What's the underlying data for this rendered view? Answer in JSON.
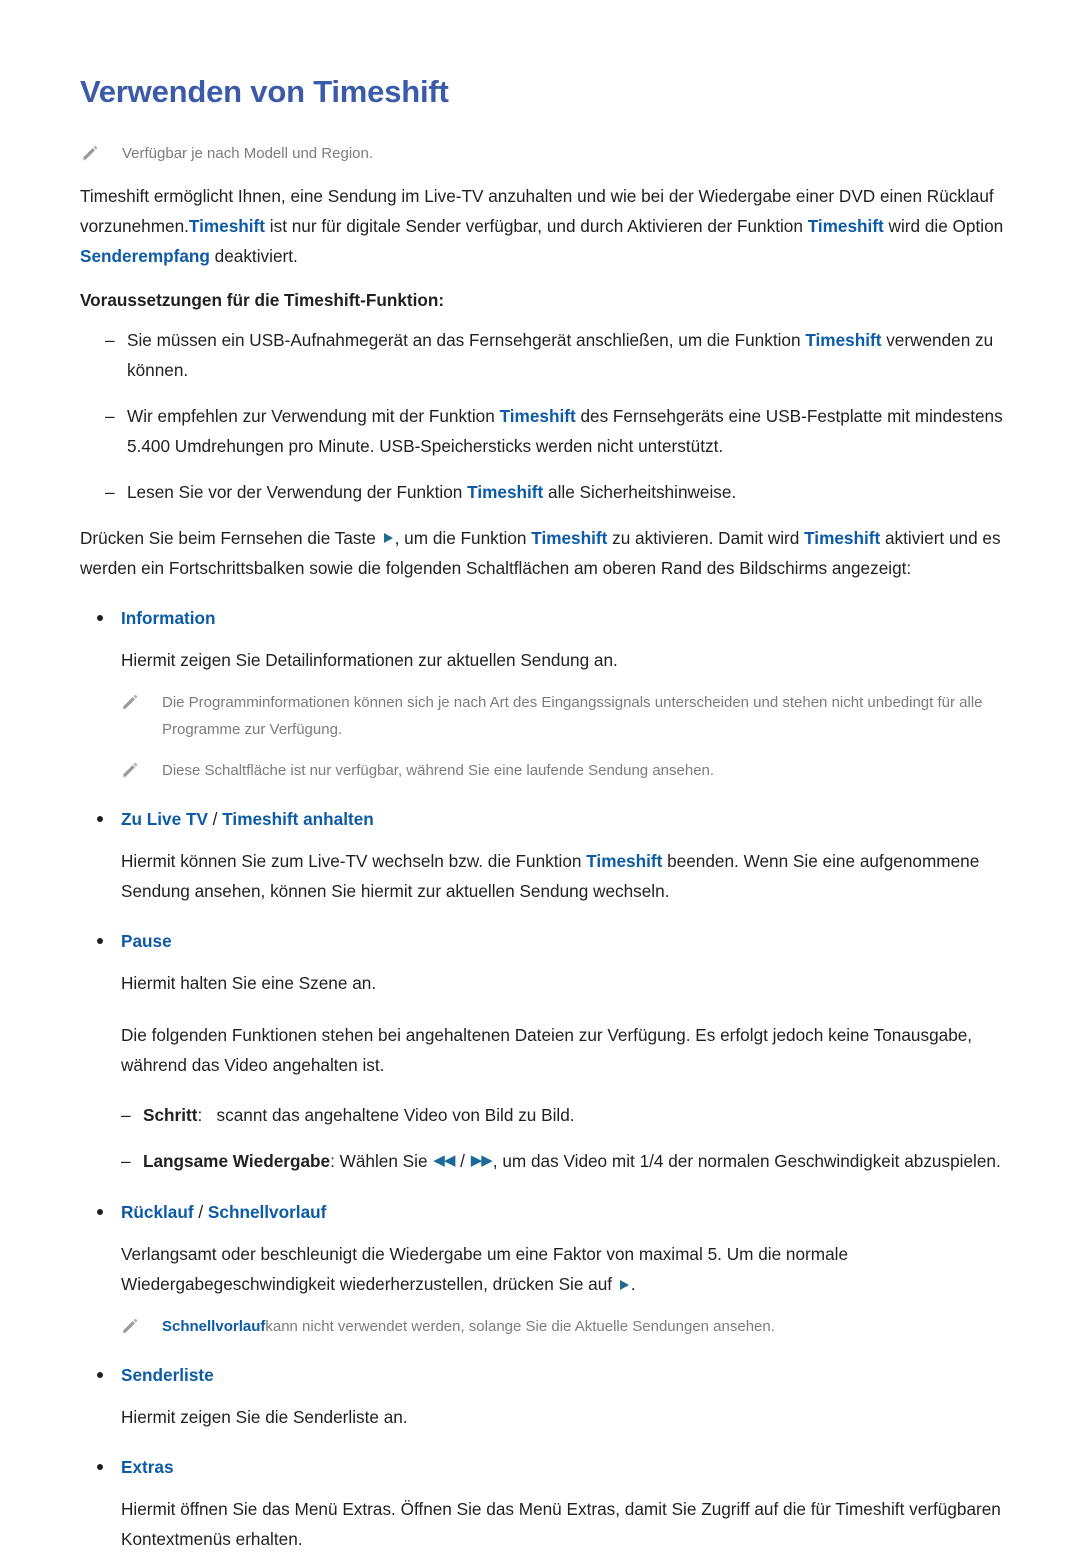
{
  "document": {
    "title": "Verwenden von Timeshift",
    "title_color": "#3b5ba9",
    "accent_color": "#0d5ba6",
    "note_color": "#7c7c7c",
    "body_color": "#231f20"
  },
  "top_note": {
    "icon": "pencil-icon",
    "text": "Verfügbar je nach Modell und Region."
  },
  "intro": {
    "p1_a": "Timeshift ermöglicht Ihnen, eine Sendung im Live-TV anzuhalten und wie bei der Wiedergabe einer DVD einen Rücklauf vorzunehmen.",
    "p1_term1": "Timeshift",
    "p1_b": " ist nur für digitale Sender verfügbar, und durch Aktivieren der Funktion ",
    "p1_term2": "Timeshift",
    "p1_c": " wird die Option ",
    "p1_term3": "Senderempfang",
    "p1_d": " deaktiviert."
  },
  "requirements": {
    "heading": "Voraussetzungen für die Timeshift-Funktion:",
    "dash": "–",
    "items": [
      {
        "a": "Sie müssen ein USB-Aufnahmegerät an das Fernsehgerät anschließen, um die Funktion ",
        "term": "Timeshift",
        "b": " verwenden zu können."
      },
      {
        "a": "Wir empfehlen zur Verwendung mit der Funktion ",
        "term": "Timeshift",
        "b": " des Fernsehgeräts eine USB-Festplatte mit mindestens 5.400 Umdrehungen pro Minute. USB-Speichersticks werden nicht unterstützt."
      },
      {
        "a": "Lesen Sie vor der Verwendung der Funktion ",
        "term": "Timeshift",
        "b": " alle Sicherheitshinweise."
      }
    ]
  },
  "activation": {
    "a": "Drücken Sie beim Fernsehen die Taste ",
    "icon": "play-icon",
    "b": ", um die Funktion ",
    "term1": "Timeshift",
    "c": " zu aktivieren. Damit wird ",
    "term2": "Timeshift",
    "d": " aktiviert und es werden ein Fortschrittsbalken sowie die folgenden Schaltflächen am oberen Rand des Bildschirms angezeigt:"
  },
  "sections": [
    {
      "id": "information",
      "bullet_label": "Information",
      "bullet_label_parts": null,
      "body": "Hiermit zeigen Sie Detailinformationen zur aktuellen Sendung an.",
      "notes": [
        "Die Programminformationen können sich je nach Art des Eingangssignals unterscheiden und stehen nicht unbedingt für alle Programme zur Verfügung.",
        "Diese Schaltfläche ist nur verfügbar, während Sie eine laufende Sendung ansehen."
      ]
    },
    {
      "id": "zu-live-tv",
      "label_part1": "Zu Live TV",
      "label_sep": " / ",
      "label_part2": "Timeshift anhalten",
      "body_a": "Hiermit können Sie zum Live-TV wechseln bzw. die Funktion ",
      "body_term": "Timeshift",
      "body_b": " beenden. Wenn Sie eine aufgenommene Sendung ansehen, können Sie hiermit zur aktuellen Sendung wechseln."
    },
    {
      "id": "pause",
      "bullet_label": "Pause",
      "body1": "Hiermit halten Sie eine Szene an.",
      "body2": "Die folgenden Funktionen stehen bei angehaltenen Dateien zur Verfügung. Es erfolgt jedoch keine Tonausgabe, während das Video angehalten ist.",
      "sub_items": [
        {
          "dash": "–",
          "bold": "Schritt",
          "colon": ":",
          "text": "scannt das angehaltene Video von Bild zu Bild."
        },
        {
          "dash": "–",
          "bold": "Langsame Wiedergabe",
          "colon": ":",
          "text_a": " Wählen Sie ",
          "icon_rw": "rewind-icon",
          "icon_sep": " / ",
          "icon_ff": "fast-forward-icon",
          "text_b": ", um das Video mit 1/4 der normalen Geschwindigkeit abzuspielen."
        }
      ]
    },
    {
      "id": "ruecklauf",
      "label_part1": "Rücklauf",
      "label_sep": " / ",
      "label_part2": "Schnellvorlauf",
      "body_a": "Verlangsamt oder beschleunigt die Wiedergabe um eine Faktor von maximal 5. Um die normale Wiedergabegeschwindigkeit wiederherzustellen, drücken Sie auf ",
      "body_icon": "play-icon",
      "body_b": ".",
      "note_term": "Schnellvorlauf",
      "note_rest": "kann nicht verwendet werden, solange Sie die Aktuelle Sendungen ansehen."
    },
    {
      "id": "senderliste",
      "bullet_label": "Senderliste",
      "body": "Hiermit zeigen Sie die Senderliste an."
    },
    {
      "id": "extras",
      "bullet_label": "Extras",
      "body": "Hiermit öffnen Sie das Menü Extras. Öffnen Sie das Menü Extras, damit Sie Zugriff auf die für Timeshift verfügbaren Kontextmenüs erhalten."
    }
  ]
}
